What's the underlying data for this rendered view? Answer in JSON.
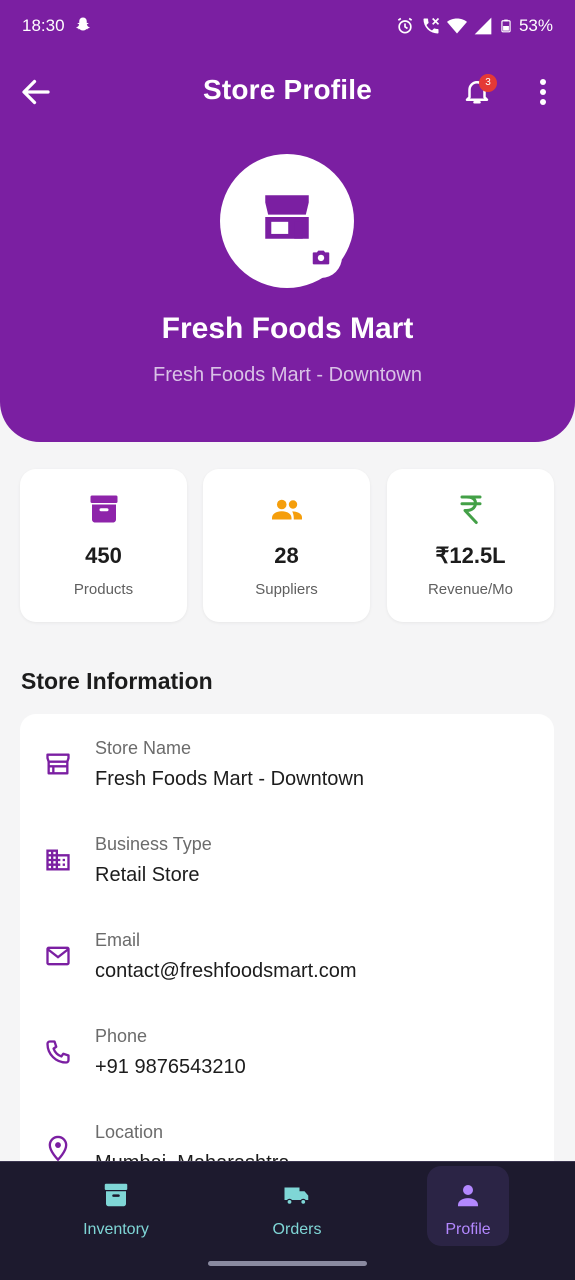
{
  "status_bar": {
    "time": "18:30",
    "battery": "53%"
  },
  "appbar": {
    "title": "Store Profile",
    "notification_count": "3"
  },
  "profile": {
    "name": "Fresh Foods Mart",
    "subtitle": "Fresh Foods Mart - Downtown"
  },
  "stats": [
    {
      "value": "450",
      "label": "Products",
      "icon": "inventory-box-icon",
      "color": "#8e24aa"
    },
    {
      "value": "28",
      "label": "Suppliers",
      "icon": "people-icon",
      "color": "#f59e0b"
    },
    {
      "value": "₹12.5L",
      "label": "Revenue/Mo",
      "icon": "rupee-icon",
      "color": "#43a047"
    }
  ],
  "section_title": "Store Information",
  "info": [
    {
      "label": "Store Name",
      "value": "Fresh Foods Mart - Downtown",
      "icon": "storefront-icon"
    },
    {
      "label": "Business Type",
      "value": "Retail Store",
      "icon": "building-icon"
    },
    {
      "label": "Email",
      "value": "contact@freshfoodsmart.com",
      "icon": "mail-icon"
    },
    {
      "label": "Phone",
      "value": "+91 9876543210",
      "icon": "phone-icon"
    },
    {
      "label": "Location",
      "value": "Mumbai, Maharashtra",
      "icon": "location-pin-icon"
    }
  ],
  "nav": [
    {
      "label": "Inventory",
      "icon": "inventory-icon",
      "color": "#7fd6d6"
    },
    {
      "label": "Orders",
      "icon": "truck-icon",
      "color": "#7fd6d6"
    },
    {
      "label": "Profile",
      "icon": "person-icon",
      "color": "#b388ff",
      "active": true
    }
  ],
  "colors": {
    "primary": "#7b1fa2",
    "nav_bg": "#1d1a2e",
    "background": "#f5f5f6"
  }
}
